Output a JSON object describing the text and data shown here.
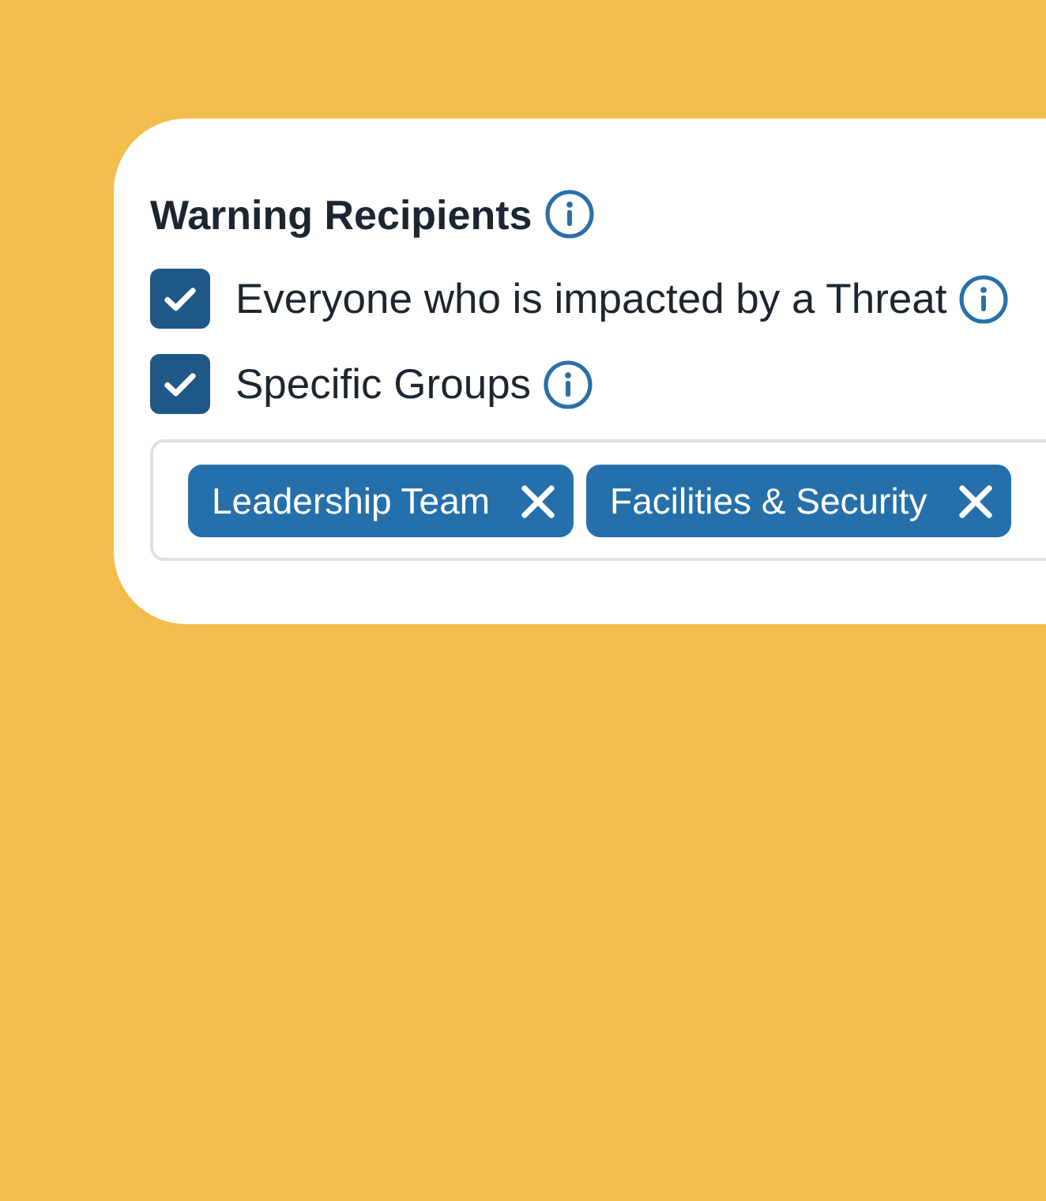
{
  "section": {
    "title": "Warning Recipients"
  },
  "options": [
    {
      "label": "Everyone who is impacted by a Threat",
      "checked": true
    },
    {
      "label": "Specific Groups",
      "checked": true
    }
  ],
  "group_field": {
    "tags": [
      {
        "label": "Leadership Team"
      },
      {
        "label": "Facilities & Security"
      }
    ]
  }
}
